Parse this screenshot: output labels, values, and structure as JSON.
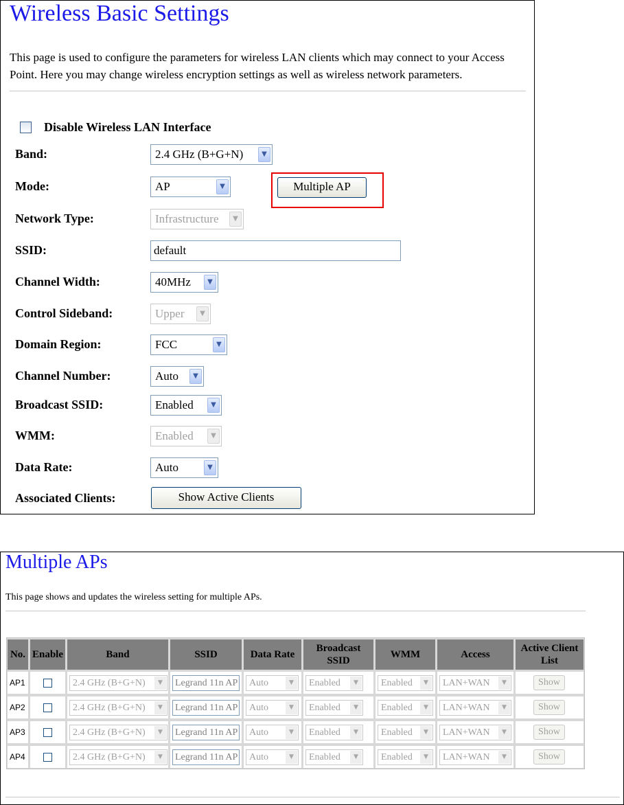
{
  "basic": {
    "title": "Wireless Basic Settings",
    "description": "This page is used to configure the parameters for wireless LAN clients which may connect to your Access Point. Here you may change wireless encryption settings as well as wireless network parameters.",
    "disable_label": "Disable Wireless LAN Interface",
    "fields": {
      "band": {
        "label": "Band:",
        "value": "2.4 GHz (B+G+N)"
      },
      "mode": {
        "label": "Mode:",
        "value": "AP"
      },
      "network_type": {
        "label": "Network Type:",
        "value": "Infrastructure"
      },
      "ssid": {
        "label": "SSID:",
        "value": "default"
      },
      "channel_width": {
        "label": "Channel Width:",
        "value": "40MHz"
      },
      "control_sideband": {
        "label": "Control Sideband:",
        "value": "Upper"
      },
      "domain_region": {
        "label": "Domain Region:",
        "value": "FCC"
      },
      "channel_number": {
        "label": "Channel Number:",
        "value": "Auto"
      },
      "broadcast_ssid": {
        "label": "Broadcast SSID:",
        "value": "Enabled"
      },
      "wmm": {
        "label": "WMM:",
        "value": "Enabled"
      },
      "data_rate": {
        "label": "Data Rate:",
        "value": "Auto"
      },
      "associated_clients": {
        "label": "Associated Clients:"
      }
    },
    "multiple_ap_button": "Multiple AP",
    "show_active_clients_button": "Show Active Clients",
    "highlight_color": "#e60000"
  },
  "multi": {
    "title": "Multiple APs",
    "description": "This page shows and updates the wireless setting for multiple APs.",
    "headers": {
      "no": "No.",
      "enable": "Enable",
      "band": "Band",
      "ssid": "SSID",
      "data_rate": "Data Rate",
      "broadcast_ssid": "Broadcast SSID",
      "wmm": "WMM",
      "access": "Access",
      "active_client_list": "Active Client List"
    },
    "rows": [
      {
        "no": "AP1",
        "band": "2.4 GHz (B+G+N)",
        "ssid": "Legrand 11n AP",
        "data_rate": "Auto",
        "broadcast": "Enabled",
        "wmm": "Enabled",
        "access": "LAN+WAN",
        "show": "Show"
      },
      {
        "no": "AP2",
        "band": "2.4 GHz (B+G+N)",
        "ssid": "Legrand 11n AP",
        "data_rate": "Auto",
        "broadcast": "Enabled",
        "wmm": "Enabled",
        "access": "LAN+WAN",
        "show": "Show"
      },
      {
        "no": "AP3",
        "band": "2.4 GHz (B+G+N)",
        "ssid": "Legrand 11n AP",
        "data_rate": "Auto",
        "broadcast": "Enabled",
        "wmm": "Enabled",
        "access": "LAN+WAN",
        "show": "Show"
      },
      {
        "no": "AP4",
        "band": "2.4 GHz (B+G+N)",
        "ssid": "Legrand 11n AP",
        "data_rate": "Auto",
        "broadcast": "Enabled",
        "wmm": "Enabled",
        "access": "LAN+WAN",
        "show": "Show"
      }
    ]
  },
  "colors": {
    "title": "#1b1ae8",
    "header_bg": "#7f7f7f"
  }
}
